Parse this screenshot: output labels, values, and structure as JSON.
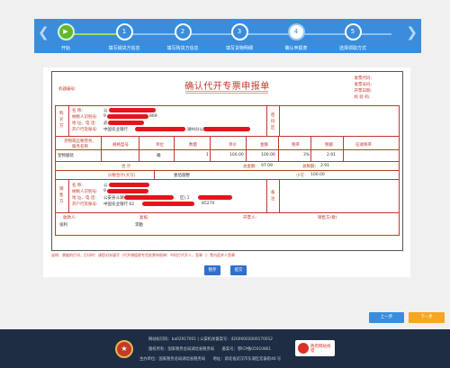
{
  "steps": [
    {
      "num": "",
      "label": "开始",
      "state": "done"
    },
    {
      "num": "1",
      "label": "填写销货方信息",
      "state": "todo"
    },
    {
      "num": "2",
      "label": "填写购货方信息",
      "state": "todo"
    },
    {
      "num": "3",
      "label": "填写货物明细",
      "state": "todo"
    },
    {
      "num": "4",
      "label": "确认申报表",
      "state": "current"
    },
    {
      "num": "5",
      "label": "选择领取方式",
      "state": "todo"
    }
  ],
  "form": {
    "title": "确认代开专票申报单",
    "jiqi_label": "机器编号:",
    "meta": [
      "发票代码:",
      "发票号码:",
      "开票日期:",
      "校 验 码:"
    ],
    "buyer": {
      "side_label": "购买方",
      "fields": [
        "名        称:",
        "纳税人识别号:",
        "地 址、电 话:",
        "开户行及账号:"
      ],
      "values": [
        "公",
        "9",
        "武",
        "中国农业银行"
      ],
      "tail_values": [
        "",
        "869",
        "",
        "湖州分公司支行"
      ],
      "pwd_label": "密码区"
    },
    "goods_header": [
      "货物或应税劳务、服务名称",
      "规格型号",
      "单位",
      "数量",
      "单价",
      "金额",
      "税率",
      "税额",
      "征收税率"
    ],
    "goods_row": {
      "name": "宠物服装",
      "spec": "",
      "unit": "箱",
      "qty": "1",
      "price": "100.00",
      "amount": "100.00",
      "rate": "3%",
      "tax": "2.91",
      "levy": ""
    },
    "total_label": "合    计",
    "total_amount_label": "总金额：",
    "total_amount": "97.09",
    "total_tax_label": "总税额：",
    "total_tax": "2.91",
    "tax_sum_label": "价税合计(大写)",
    "tax_sum_words": "壹佰圆整",
    "tax_sum_small_label": "小写：",
    "tax_sum_small": "100.00",
    "seller": {
      "side_label": "销售方",
      "fields": [
        "名        称:",
        "纳税人识别号:",
        "地 址、电 话:",
        "开户行及账号:"
      ],
      "values": [
        "公",
        "9",
        "公安县斗湖",
        "中国农业银行 62"
      ],
      "tail_values": [
        "",
        "",
        "区)    1",
        "85270"
      ],
      "remark_label": "备注"
    },
    "sign": [
      {
        "label": "收款人:",
        "value": "张利"
      },
      {
        "label": "复核:",
        "value": "李勤"
      },
      {
        "label": "开票人:",
        "value": ""
      },
      {
        "label": "销售方(章)",
        "value": ""
      }
    ]
  },
  "note": "说明：票据的打印，打印时：请您对本填写（代开增值税专用发票申报单）中机打代开人，签章（）等内容并人签章",
  "buttons": {
    "save": "暂存",
    "submit": "提交",
    "prev": "上一步",
    "next": "下一步"
  },
  "footer": {
    "line1": "网站标识码：ba02917001 | 公安机关备案号：42000002000170012",
    "line2": "版权所有：国家税务总局湖北省税务局　　备案号：鄂ICP备05010861",
    "line3": "主办单位：国家税务总局湖北省税务局　　地址：湖北省武汉市东湖区宏泰街46 号",
    "badge": "政府网站找错"
  },
  "colors": {
    "accent": "#3a8ddc",
    "done": "#5fb82e",
    "red": "#c0392b",
    "next": "#f5a623"
  }
}
